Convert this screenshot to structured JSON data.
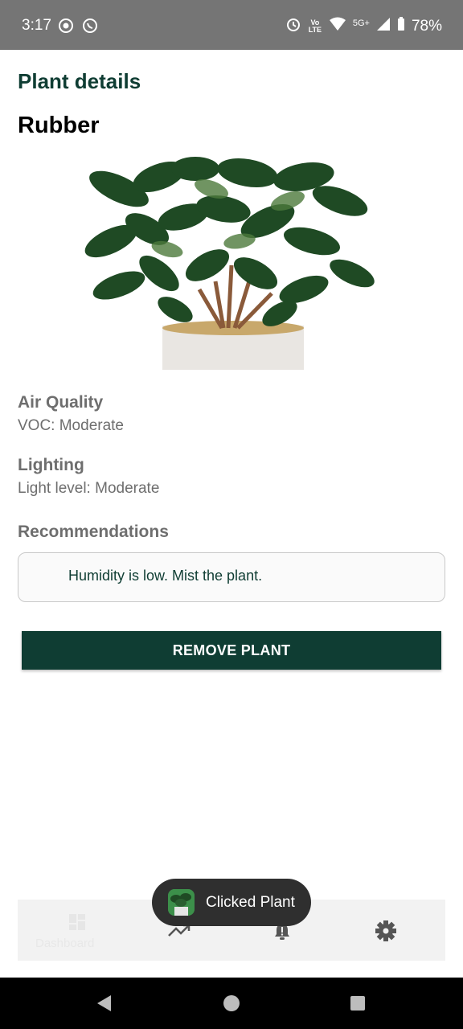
{
  "status_bar": {
    "time": "3:17",
    "battery": "78%",
    "network": "5G+",
    "volte": "Vo LTE"
  },
  "header": {
    "title": "Plant details"
  },
  "plant": {
    "name": "Rubber"
  },
  "sections": {
    "air_quality": {
      "title": "Air Quality",
      "value": "VOC: Moderate"
    },
    "lighting": {
      "title": "Lighting",
      "value": "Light level: Moderate"
    },
    "recommendations": {
      "title": "Recommendations",
      "text": "Humidity is low. Mist the plant."
    }
  },
  "actions": {
    "remove_label": "REMOVE PLANT"
  },
  "bottom_nav": {
    "items": [
      {
        "label": "Dashboard",
        "icon": "dashboard-icon"
      },
      {
        "label": "",
        "icon": "trending-up-icon"
      },
      {
        "label": "",
        "icon": "alert-icon"
      },
      {
        "label": "",
        "icon": "gear-icon"
      }
    ]
  },
  "toast": {
    "text": "Clicked Plant"
  },
  "colors": {
    "primary": "#0f3d33",
    "status_bar": "#757575",
    "toast_bg": "#2f2f2f"
  }
}
